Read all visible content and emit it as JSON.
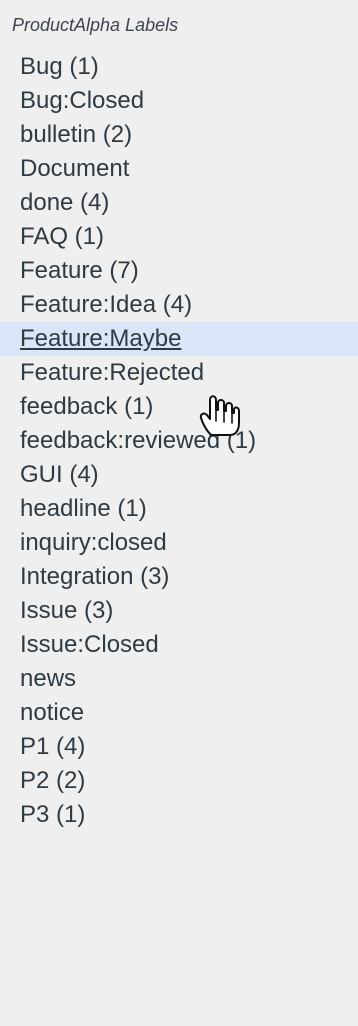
{
  "panel": {
    "title": "ProductAlpha Labels",
    "labels": [
      "Bug (1)",
      "Bug:Closed",
      "bulletin (2)",
      "Document",
      "done (4)",
      "FAQ (1)",
      "Feature (7)",
      "Feature:Idea (4)",
      "Feature:Maybe",
      "Feature:Rejected",
      "feedback (1)",
      "feedback:reviewed (1)",
      "GUI (4)",
      "headline (1)",
      "inquiry:closed",
      "Integration (3)",
      "Issue (3)",
      "Issue:Closed",
      "news",
      "notice",
      "P1 (4)",
      "P2 (2)",
      "P3 (1)"
    ],
    "hovered_label": "Feature:Maybe"
  },
  "colors": {
    "panel_background": "#efefef",
    "hover_background": "#d9e6f7",
    "text": "#2f3a43",
    "title": "#3d4550"
  },
  "icons": {
    "cursor": "hand-pointer-icon"
  }
}
